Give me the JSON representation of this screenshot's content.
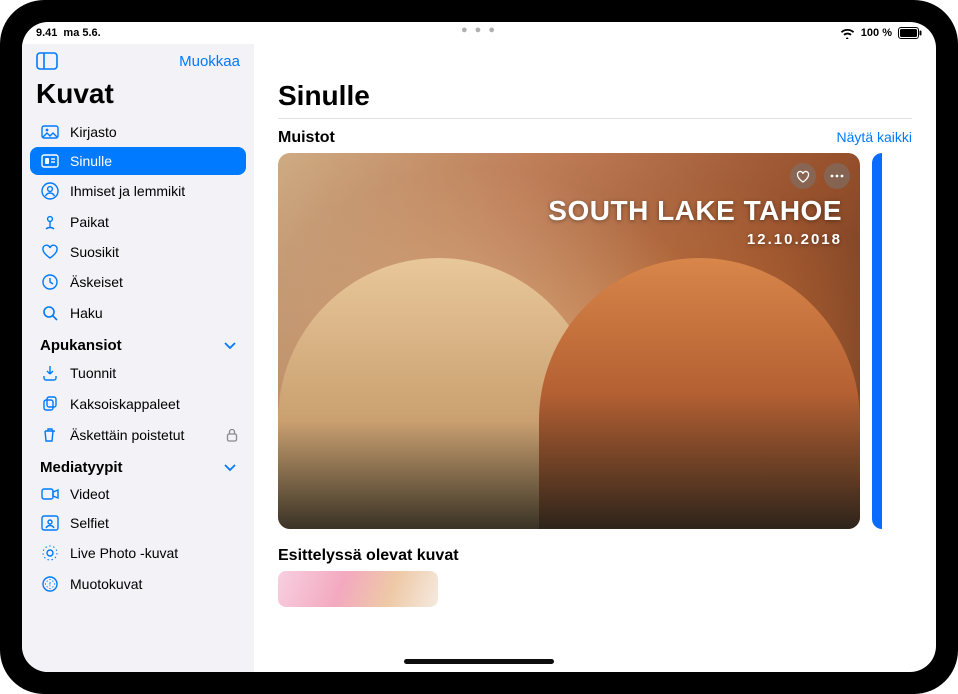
{
  "statusbar": {
    "time": "9.41",
    "date": "ma 5.6.",
    "battery": "100 %"
  },
  "sidebar": {
    "edit": "Muokkaa",
    "title": "Kuvat",
    "items": [
      {
        "label": "Kirjasto"
      },
      {
        "label": "Sinulle"
      },
      {
        "label": "Ihmiset ja lemmikit"
      },
      {
        "label": "Paikat"
      },
      {
        "label": "Suosikit"
      },
      {
        "label": "Äskeiset"
      },
      {
        "label": "Haku"
      }
    ],
    "section_utilities": "Apukansiot",
    "utilities": [
      {
        "label": "Tuonnit"
      },
      {
        "label": "Kaksoiskappaleet"
      },
      {
        "label": "Äskettäin poistetut"
      }
    ],
    "section_mediatypes": "Mediatyypit",
    "mediatypes": [
      {
        "label": "Videot"
      },
      {
        "label": "Selfiet"
      },
      {
        "label": "Live Photo ‑kuvat"
      },
      {
        "label": "Muotokuvat"
      }
    ]
  },
  "main": {
    "page_title": "Sinulle",
    "memories_label": "Muistot",
    "show_all": "Näytä kaikki",
    "memory": {
      "title": "SOUTH LAKE TAHOE",
      "date": "12.10.2018"
    },
    "featured_label": "Esittelyssä olevat kuvat"
  }
}
